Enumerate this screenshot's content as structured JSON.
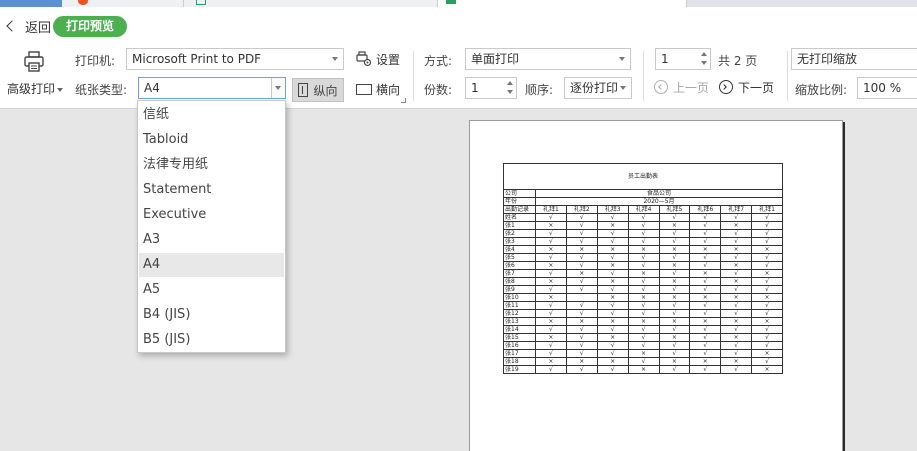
{
  "toolbar": {
    "back_label": "返回",
    "mode_label": "打印预览",
    "advanced_print_label": "高级打印",
    "printer_label": "打印机:",
    "printer_value": "Microsoft Print to PDF",
    "paper_type_label": "纸张类型:",
    "paper_type_value": "A4",
    "settings_label": "设置",
    "portrait_label": "纵向",
    "landscape_label": "横向",
    "method_label": "方式:",
    "method_value": "单面打印",
    "copies_label": "份数:",
    "copies_value": "1",
    "order_label": "顺序:",
    "order_value": "逐份打印",
    "page_value": "1",
    "total_pages": "共 2 页",
    "prev_page_label": "上一页",
    "next_page_label": "下一页",
    "scale_mode_value": "无打印缩放",
    "zoom_label": "缩放比例:",
    "zoom_value": "100 %"
  },
  "paper_dropdown": {
    "options": [
      "信纸",
      "Tabloid",
      "法律专用纸",
      "Statement",
      "Executive",
      "A3",
      "A4",
      "A5",
      "B4 (JIS)",
      "B5 (JIS)"
    ],
    "selected": "A4"
  },
  "preview": {
    "title": "员工出勤表",
    "company_label": "公司",
    "company_value": "食品公司",
    "month_label": "年份",
    "month_value": "2020—5月",
    "header": [
      "出勤记录",
      "礼拜1",
      "礼拜2",
      "礼拜3",
      "礼拜4",
      "礼拜5",
      "礼拜6",
      "礼拜7",
      "礼拜1"
    ],
    "rows": [
      [
        "姓名",
        "√",
        "√",
        "√",
        "√",
        "√",
        "√",
        "√",
        "√"
      ],
      [
        "张1",
        "×",
        "√",
        "×",
        "√",
        "×",
        "√",
        "×",
        "√"
      ],
      [
        "张2",
        "√",
        "√",
        "√",
        "√",
        "√",
        "√",
        "√",
        "√"
      ],
      [
        "张3",
        "√",
        "√",
        "√",
        "√",
        "√",
        "√",
        "√",
        "√"
      ],
      [
        "张4",
        "×",
        "×",
        "×",
        "×",
        "×",
        "×",
        "×",
        "×"
      ],
      [
        "张5",
        "√",
        "√",
        "√",
        "√",
        "√",
        "√",
        "√",
        "√"
      ],
      [
        "张6",
        "×",
        "√",
        "×",
        "√",
        "×",
        "√",
        "×",
        "√"
      ],
      [
        "张7",
        "√",
        "×",
        "√",
        "×",
        "√",
        "×",
        "√",
        "×"
      ],
      [
        "张8",
        "×",
        "√",
        "×",
        "√",
        "×",
        "√",
        "×",
        "√"
      ],
      [
        "张9",
        "√",
        "√",
        "√",
        "√",
        "√",
        "√",
        "√",
        "√"
      ],
      [
        "张10",
        "×",
        "",
        "×",
        "×",
        "×",
        "×",
        "×",
        "×"
      ],
      [
        "张11",
        "√",
        "√",
        "√",
        "√",
        "√",
        "√",
        "√",
        "√"
      ],
      [
        "张12",
        "√",
        "√",
        "√",
        "√",
        "√",
        "√",
        "√",
        "√"
      ],
      [
        "张13",
        "×",
        "×",
        "×",
        "×",
        "×",
        "×",
        "×",
        "×"
      ],
      [
        "张14",
        "√",
        "√",
        "√",
        "√",
        "√",
        "√",
        "√",
        "√"
      ],
      [
        "张15",
        "×",
        "√",
        "×",
        "√",
        "×",
        "√",
        "×",
        "√"
      ],
      [
        "张16",
        "√",
        "√",
        "√",
        "√",
        "√",
        "√",
        "√",
        "√"
      ],
      [
        "张17",
        "√",
        "√",
        "√",
        "×",
        "√",
        "√",
        "√",
        "×"
      ],
      [
        "张18",
        "×",
        "×",
        "×",
        "√",
        "×",
        "×",
        "×",
        "√"
      ],
      [
        "张19",
        "√",
        "√",
        "√",
        "×",
        "√",
        "√",
        "√",
        "×"
      ]
    ]
  }
}
